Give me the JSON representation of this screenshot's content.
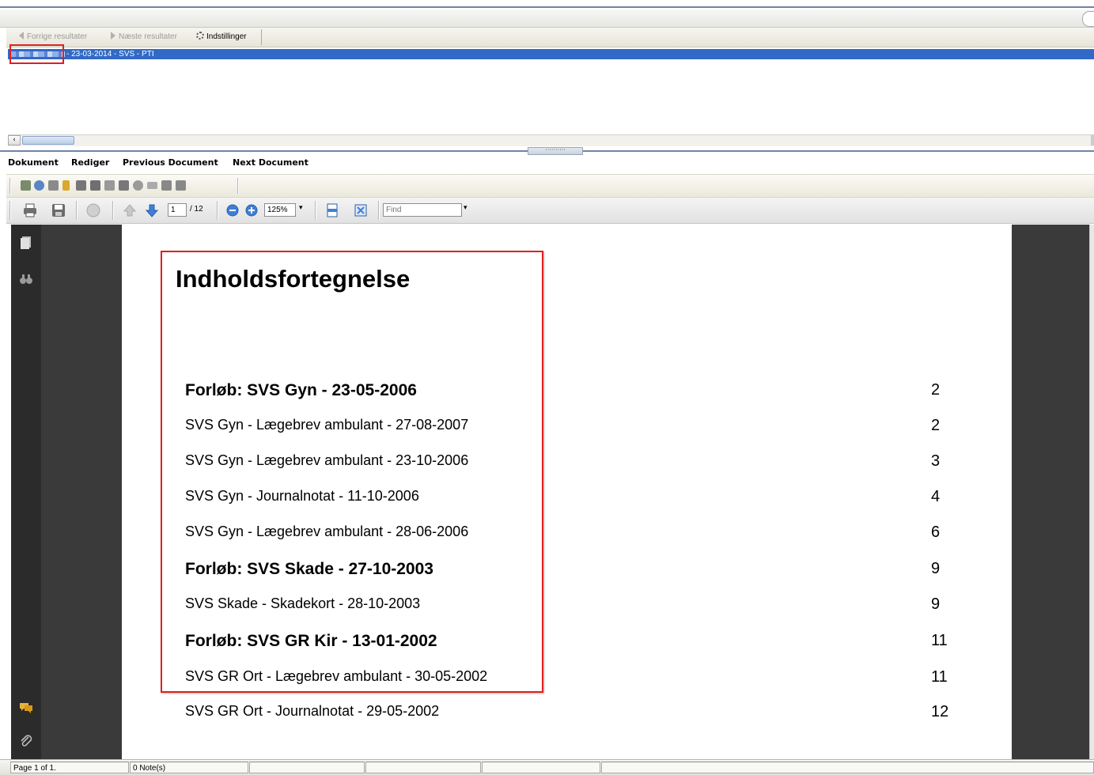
{
  "results_toolbar": {
    "prev_label": "Forrige resultater",
    "next_label": "Næste resultater",
    "settings_label": "Indstillinger"
  },
  "results_list": {
    "rows": [
      {
        "text": " - 23-03-2014 - SVS - PTI"
      }
    ]
  },
  "menu": {
    "items": [
      "Dokument",
      "Rediger",
      "Previous Document",
      "Next Document"
    ]
  },
  "pdf_toolbar": {
    "page_current": "1",
    "page_total": "/ 12",
    "zoom": "125%",
    "find_placeholder": "Find"
  },
  "document": {
    "title": "Indholdsfortegnelse",
    "entries": [
      {
        "text": "Forløb: SVS Gyn - 23-05-2006",
        "page": "2",
        "heading": true
      },
      {
        "text": "SVS Gyn - Lægebrev ambulant - 27-08-2007",
        "page": "2",
        "heading": false
      },
      {
        "text": "SVS Gyn - Lægebrev ambulant - 23-10-2006",
        "page": "3",
        "heading": false
      },
      {
        "text": "SVS Gyn - Journalnotat - 11-10-2006",
        "page": "4",
        "heading": false
      },
      {
        "text": "SVS Gyn - Lægebrev ambulant - 28-06-2006",
        "page": "6",
        "heading": false
      },
      {
        "text": "Forløb: SVS Skade - 27-10-2003",
        "page": "9",
        "heading": true
      },
      {
        "text": "SVS Skade - Skadekort - 28-10-2003",
        "page": "9",
        "heading": false
      },
      {
        "text": "Forløb: SVS GR Kir - 13-01-2002",
        "page": "11",
        "heading": true
      },
      {
        "text": "SVS GR Ort - Lægebrev ambulant - 30-05-2002",
        "page": "11",
        "heading": false
      },
      {
        "text": "SVS GR Ort - Journalnotat - 29-05-2002",
        "page": "12",
        "heading": false
      }
    ]
  },
  "status": {
    "page_info": "Page 1 of 1.",
    "notes": "0 Note(s)"
  },
  "colors": {
    "selection": "#3169c6",
    "highlight_box": "#e02020",
    "viewer_bg": "#3a3a3a"
  }
}
